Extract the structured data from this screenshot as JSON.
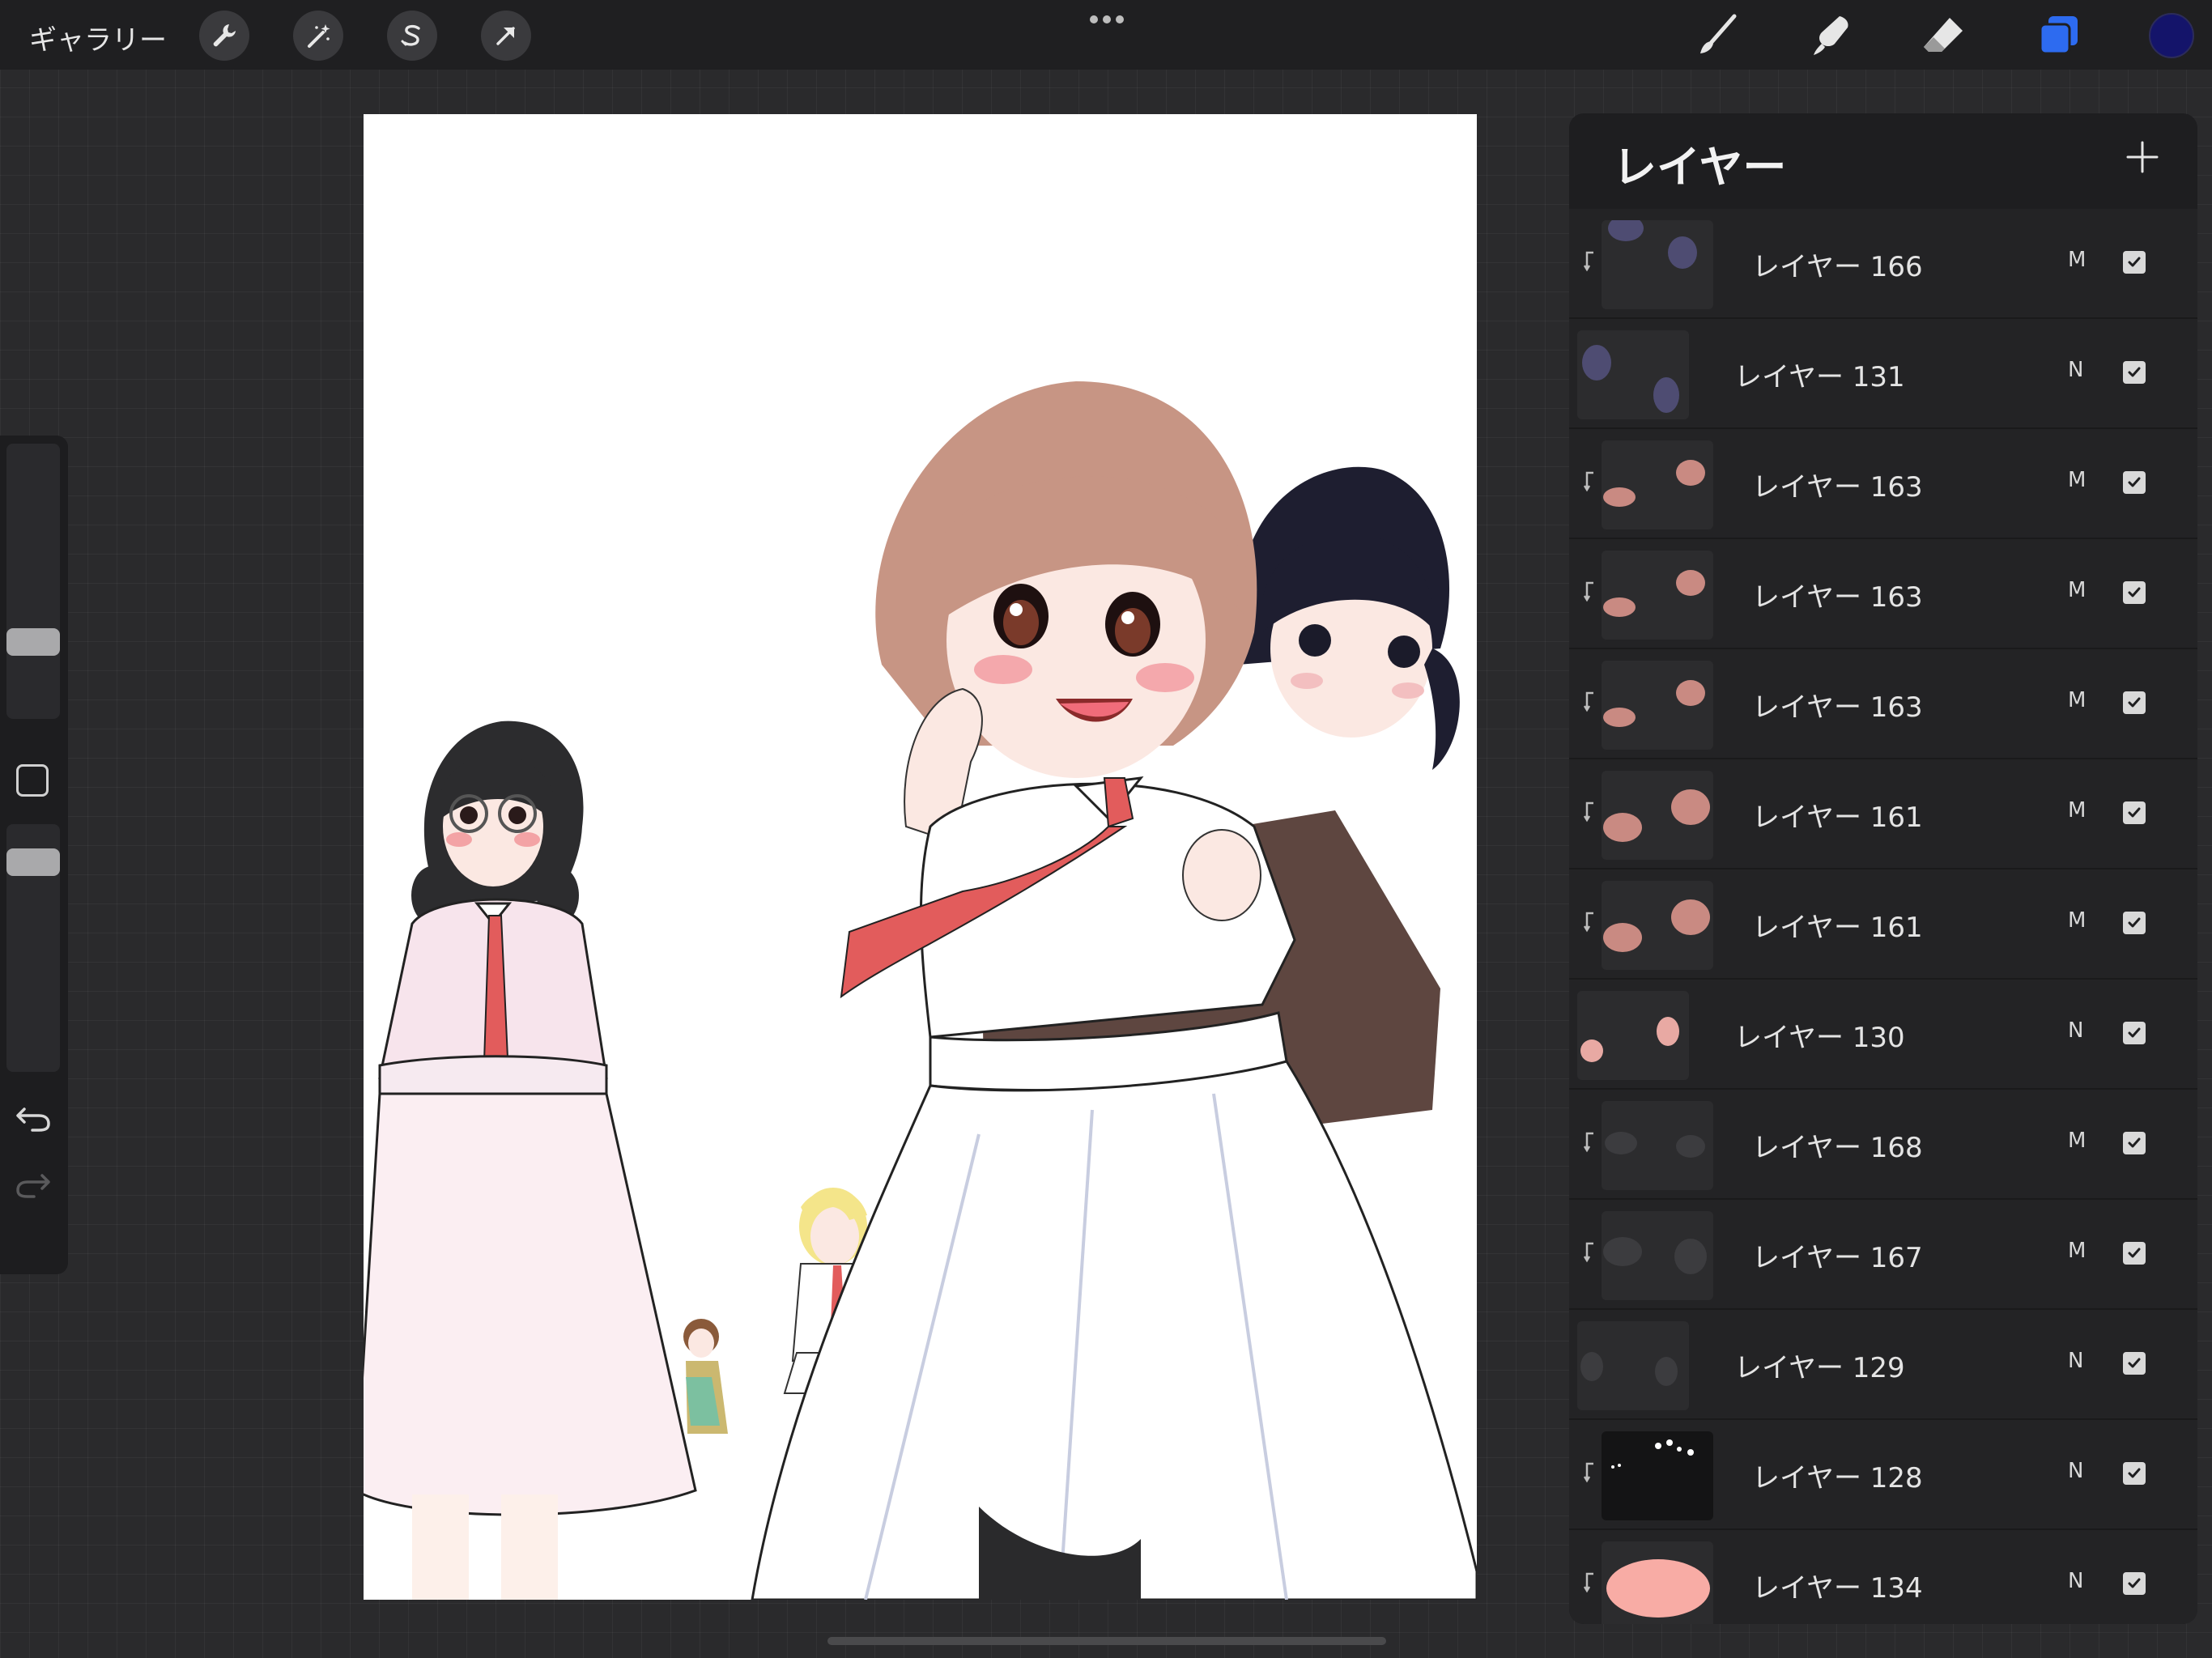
{
  "topbar": {
    "gallery_label": "ギャラリー",
    "left_tools": [
      {
        "name": "actions",
        "icon": "wrench-icon"
      },
      {
        "name": "adjustments",
        "icon": "magic-wand-icon"
      },
      {
        "name": "selection",
        "icon": "selection-s-icon"
      },
      {
        "name": "transform",
        "icon": "arrow-cursor-icon"
      }
    ],
    "more_icon": "more-dots-icon",
    "right_tools": [
      {
        "name": "brush",
        "icon": "brush-icon",
        "active": false
      },
      {
        "name": "smudge",
        "icon": "smudge-icon",
        "active": false
      },
      {
        "name": "eraser",
        "icon": "eraser-icon",
        "active": false
      },
      {
        "name": "layers",
        "icon": "layers-icon",
        "active": true
      }
    ],
    "active_color": "#14146a",
    "accent_color": "#2d6bf0"
  },
  "sidebar": {
    "brush_size_slider_icon": "brush-size-slider",
    "opacity_slider_icon": "opacity-slider",
    "modify_icon": "modify-square-icon",
    "undo_icon": "undo-icon",
    "redo_icon": "redo-icon"
  },
  "canvas": {
    "description_icon": "artwork-canvas"
  },
  "layers_panel": {
    "title": "レイヤー",
    "add_icon": "plus-icon",
    "layers": [
      {
        "name": "レイヤー 166",
        "blend": "M",
        "visible": true,
        "clipped": true,
        "thumb": "purple-blobs"
      },
      {
        "name": "レイヤー 131",
        "blend": "N",
        "visible": true,
        "clipped": false,
        "thumb": "purple-blobs-large"
      },
      {
        "name": "レイヤー 163",
        "blend": "M",
        "visible": true,
        "clipped": true,
        "thumb": "pink-blush"
      },
      {
        "name": "レイヤー 163",
        "blend": "M",
        "visible": true,
        "clipped": true,
        "thumb": "pink-blush"
      },
      {
        "name": "レイヤー 163",
        "blend": "M",
        "visible": true,
        "clipped": true,
        "thumb": "pink-blush"
      },
      {
        "name": "レイヤー 161",
        "blend": "M",
        "visible": true,
        "clipped": true,
        "thumb": "pink-large"
      },
      {
        "name": "レイヤー 161",
        "blend": "M",
        "visible": true,
        "clipped": true,
        "thumb": "pink-large"
      },
      {
        "name": "レイヤー 130",
        "blend": "N",
        "visible": true,
        "clipped": false,
        "thumb": "pink-spots"
      },
      {
        "name": "レイヤー 168",
        "blend": "M",
        "visible": true,
        "clipped": true,
        "thumb": "grey-blobs"
      },
      {
        "name": "レイヤー 167",
        "blend": "M",
        "visible": true,
        "clipped": true,
        "thumb": "grey-blobs-large"
      },
      {
        "name": "レイヤー 129",
        "blend": "N",
        "visible": true,
        "clipped": false,
        "thumb": "grey-dots"
      },
      {
        "name": "レイヤー 128",
        "blend": "N",
        "visible": true,
        "clipped": true,
        "thumb": "white-dots"
      },
      {
        "name": "レイヤー 134",
        "blend": "N",
        "visible": true,
        "clipped": true,
        "thumb": "pink-ellipse"
      }
    ]
  }
}
